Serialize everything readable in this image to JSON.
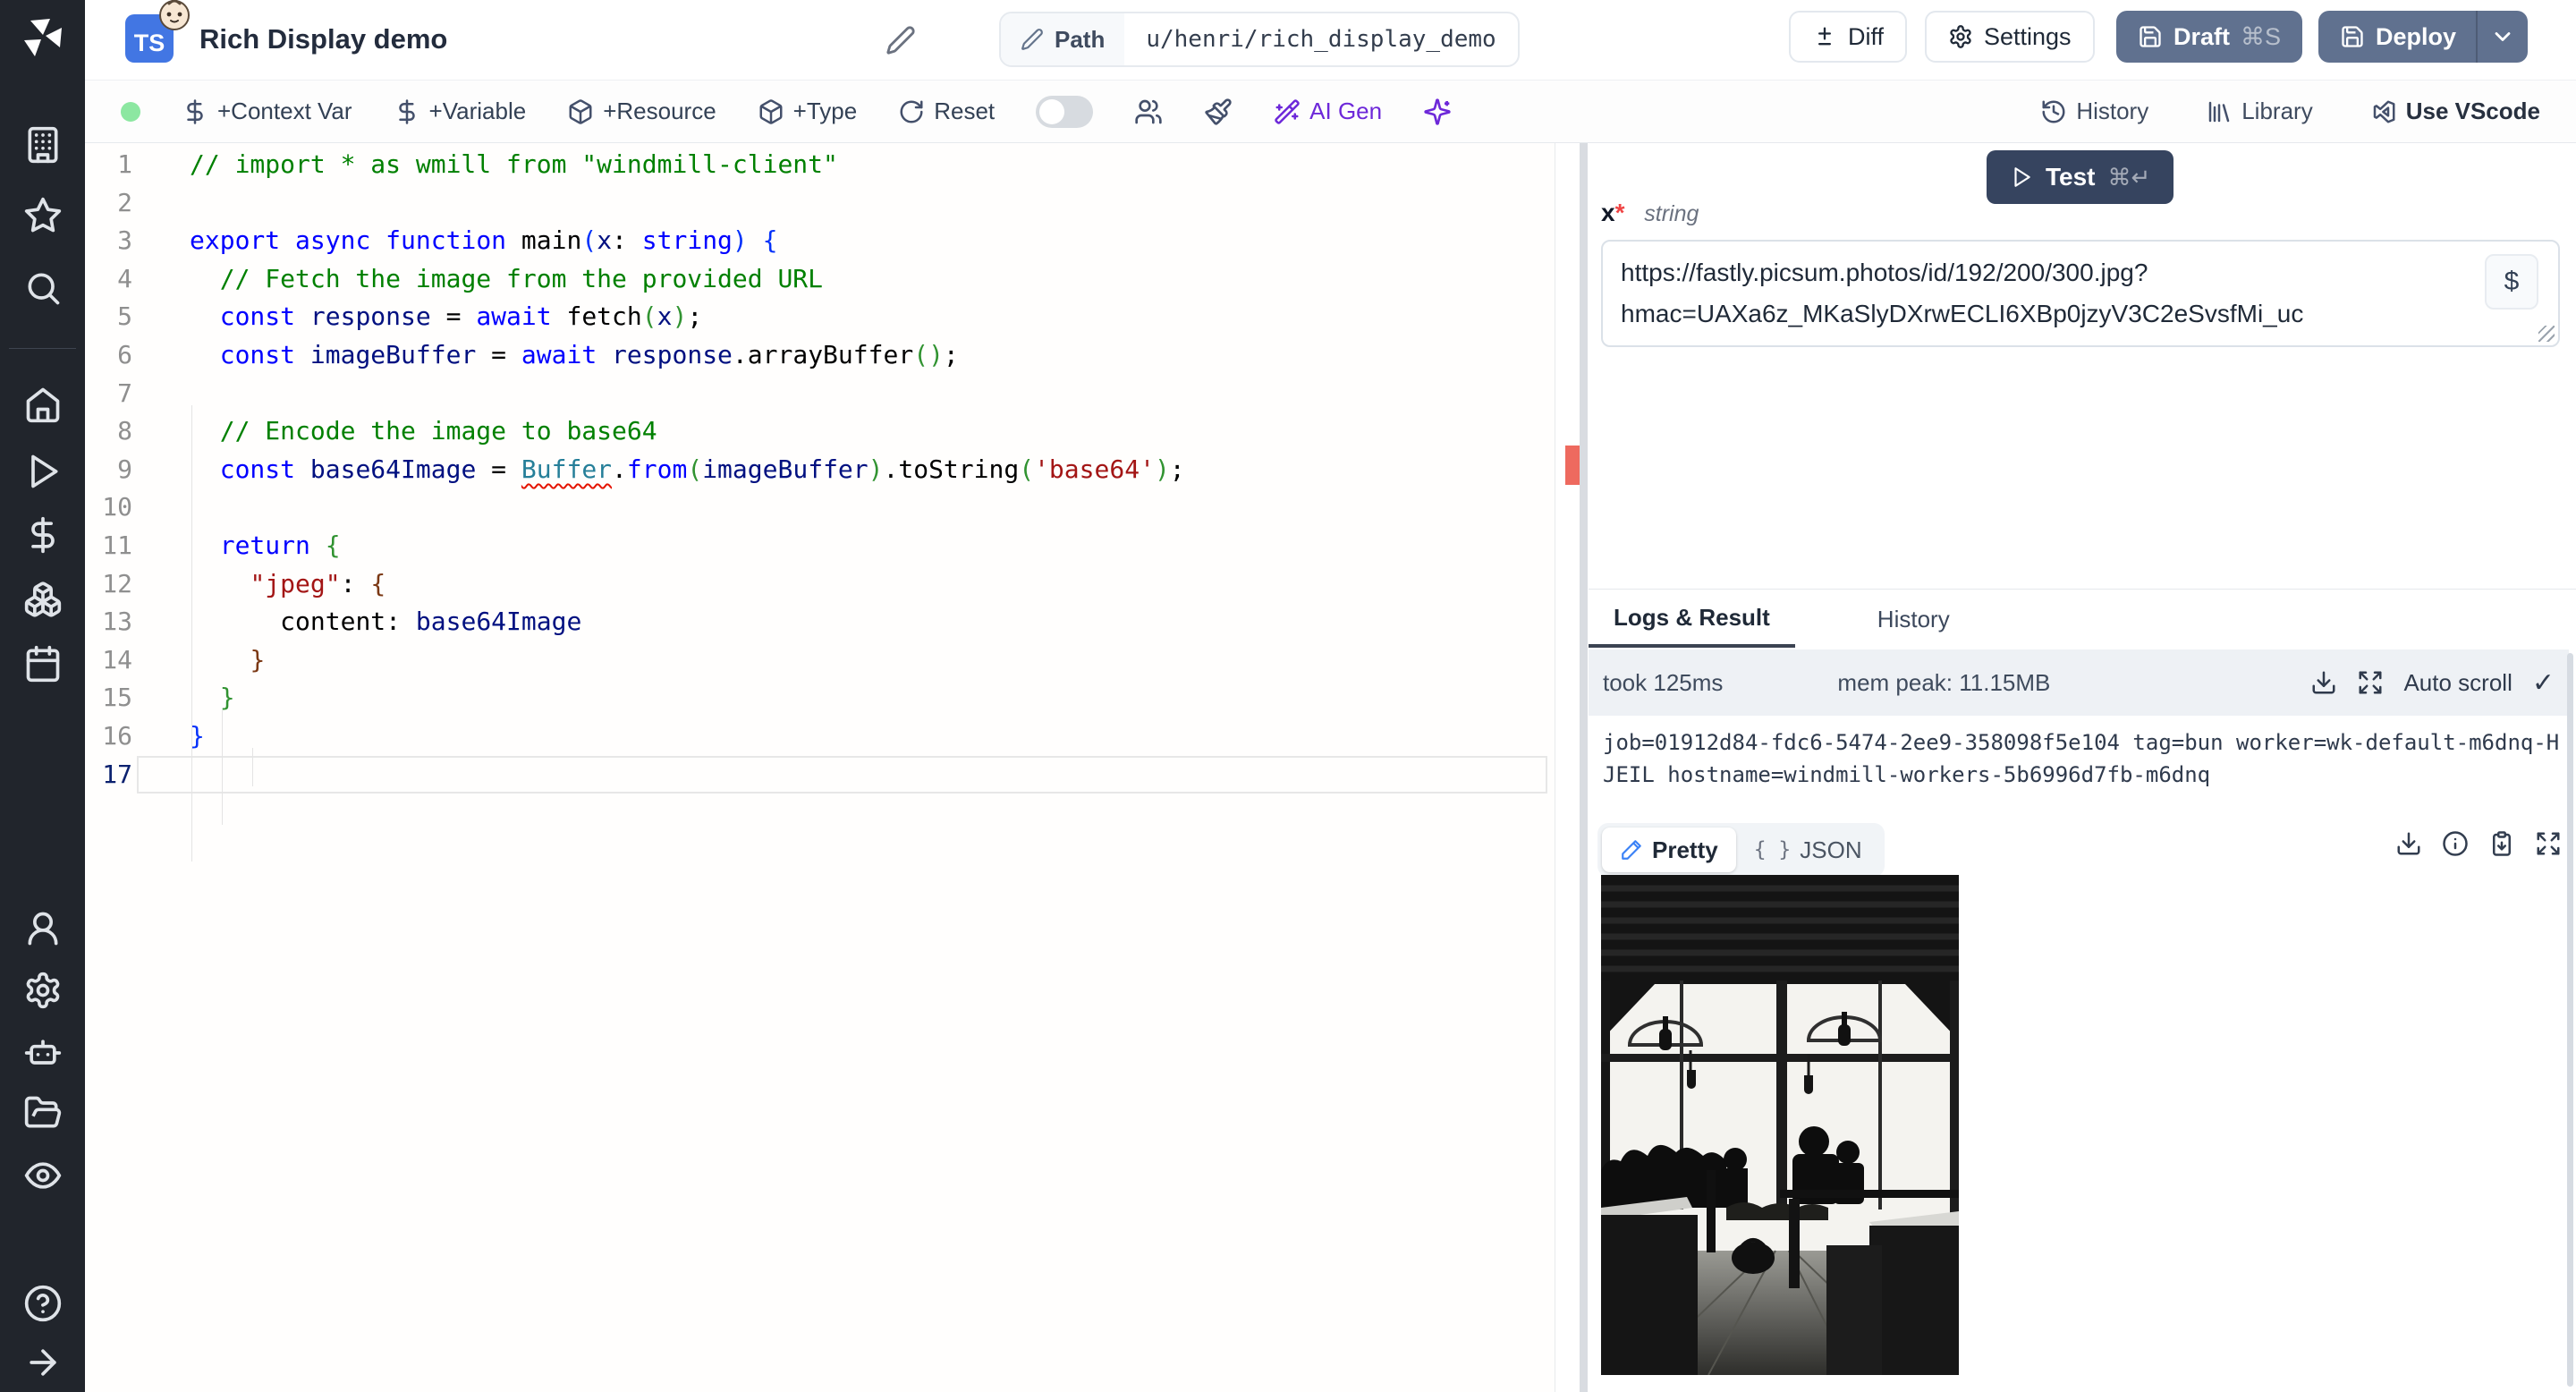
{
  "sidebar": {
    "icons": [
      "building",
      "star",
      "search",
      "home",
      "play",
      "dollar",
      "boxes",
      "calendar",
      "user",
      "settings",
      "bot",
      "folder-open",
      "eye",
      "help",
      "arrow-right"
    ]
  },
  "header": {
    "badge": "TS",
    "title": "Rich Display demo",
    "path_label": "Path",
    "path_value": "u/henri/rich_display_demo",
    "diff": "Diff",
    "settings": "Settings",
    "draft": "Draft",
    "draft_shortcut": "⌘S",
    "deploy": "Deploy"
  },
  "toolbar": {
    "context_var": "+Context Var",
    "variable": "+Variable",
    "resource": "+Resource",
    "type": "+Type",
    "reset": "Reset",
    "ai_gen": "AI Gen",
    "history": "History",
    "library": "Library",
    "use_vscode": "Use VScode"
  },
  "editor": {
    "lines": [
      {
        "n": "1",
        "tokens": [
          [
            "// import * as wmill from \"windmill-client\"",
            "cm"
          ]
        ]
      },
      {
        "n": "2",
        "tokens": []
      },
      {
        "n": "3",
        "tokens": [
          [
            "export",
            "kw"
          ],
          [
            " ",
            "df"
          ],
          [
            "async",
            "kw"
          ],
          [
            " ",
            "df"
          ],
          [
            "function",
            "kw"
          ],
          [
            " ",
            "df"
          ],
          [
            "main",
            "df"
          ],
          [
            "(",
            "b1"
          ],
          [
            "x",
            "vr"
          ],
          [
            ": ",
            "df"
          ],
          [
            "string",
            "kw"
          ],
          [
            ")",
            "b1"
          ],
          [
            " ",
            "df"
          ],
          [
            "{",
            "b1"
          ]
        ]
      },
      {
        "n": "4",
        "tokens": [
          [
            "  ",
            "df"
          ],
          [
            "// Fetch the image from the provided URL",
            "cm"
          ]
        ]
      },
      {
        "n": "5",
        "tokens": [
          [
            "  ",
            "df"
          ],
          [
            "const",
            "kw"
          ],
          [
            " ",
            "df"
          ],
          [
            "response",
            "vr"
          ],
          [
            " = ",
            "df"
          ],
          [
            "await",
            "kw"
          ],
          [
            " ",
            "df"
          ],
          [
            "fetch",
            "df"
          ],
          [
            "(",
            "b2"
          ],
          [
            "x",
            "vr"
          ],
          [
            ")",
            "b2"
          ],
          [
            ";",
            "df"
          ]
        ]
      },
      {
        "n": "6",
        "tokens": [
          [
            "  ",
            "df"
          ],
          [
            "const",
            "kw"
          ],
          [
            " ",
            "df"
          ],
          [
            "imageBuffer",
            "vr"
          ],
          [
            " = ",
            "df"
          ],
          [
            "await",
            "kw"
          ],
          [
            " ",
            "df"
          ],
          [
            "response",
            "vr"
          ],
          [
            ".",
            "df"
          ],
          [
            "arrayBuffer",
            "df"
          ],
          [
            "(",
            "b2"
          ],
          [
            ")",
            "b2"
          ],
          [
            ";",
            "df"
          ]
        ]
      },
      {
        "n": "7",
        "tokens": []
      },
      {
        "n": "8",
        "tokens": [
          [
            "  ",
            "df"
          ],
          [
            "// Encode the image to base64",
            "cm"
          ]
        ]
      },
      {
        "n": "9",
        "tokens": [
          [
            "  ",
            "df"
          ],
          [
            "const",
            "kw"
          ],
          [
            " ",
            "df"
          ],
          [
            "base64Image",
            "vr"
          ],
          [
            " = ",
            "df"
          ],
          [
            "Buffer",
            "er"
          ],
          [
            ".",
            "df"
          ],
          [
            "from",
            "kw"
          ],
          [
            "(",
            "b2"
          ],
          [
            "imageBuffer",
            "vr"
          ],
          [
            ")",
            "b2"
          ],
          [
            ".",
            "df"
          ],
          [
            "toString",
            "df"
          ],
          [
            "(",
            "b2"
          ],
          [
            "'base64'",
            "st"
          ],
          [
            ")",
            "b2"
          ],
          [
            ";",
            "df"
          ]
        ]
      },
      {
        "n": "10",
        "tokens": []
      },
      {
        "n": "11",
        "tokens": [
          [
            "  ",
            "df"
          ],
          [
            "return",
            "kw"
          ],
          [
            " ",
            "df"
          ],
          [
            "{",
            "b2"
          ]
        ]
      },
      {
        "n": "12",
        "tokens": [
          [
            "    ",
            "df"
          ],
          [
            "\"jpeg\"",
            "st"
          ],
          [
            ": ",
            "df"
          ],
          [
            "{",
            "b3"
          ]
        ]
      },
      {
        "n": "13",
        "tokens": [
          [
            "      ",
            "df"
          ],
          [
            "content",
            "df"
          ],
          [
            ": ",
            "df"
          ],
          [
            "base64Image",
            "vr"
          ]
        ]
      },
      {
        "n": "14",
        "tokens": [
          [
            "    ",
            "df"
          ],
          [
            "}",
            "b3"
          ]
        ]
      },
      {
        "n": "15",
        "tokens": [
          [
            "  ",
            "df"
          ],
          [
            "}",
            "b2"
          ]
        ]
      },
      {
        "n": "16",
        "tokens": [
          [
            "}",
            "b1"
          ]
        ]
      },
      {
        "n": "17",
        "tokens": [],
        "current": true
      }
    ]
  },
  "runner": {
    "test": "Test",
    "test_shortcut": "⌘↵",
    "arg_name": "x",
    "arg_required": "*",
    "arg_type": "string",
    "arg_value": "https://fastly.picsum.photos/id/192/200/300.jpg?hmac=UAXa6z_MKaSlyDXrwECLI6XBp0jzyV3C2eSvsfMi_uc",
    "var_picker": "$"
  },
  "results": {
    "tab_logs": "Logs & Result",
    "tab_history": "History",
    "took": "took 125ms",
    "mem": "mem peak: 11.15MB",
    "autoscroll": "Auto scroll",
    "check": "✓",
    "log": "job=01912d84-fdc6-5474-2ee9-358098f5e104 tag=bun worker=wk-default-m6dnq-HJEIL hostname=windmill-workers-5b6996d7fb-m6dnq",
    "pretty": "Pretty",
    "json_glyph": "{ }",
    "json": "JSON",
    "image_description": "black and white photo of a cafe interior: silhouettes of people seated at tables in front of a large gridded window with pendant lamps and a wooden floor"
  },
  "colors": {
    "accent_blue": "#4276e3",
    "deploy_button": "#60718f",
    "test_button": "#36445f",
    "ai_purple": "#6d28d9",
    "status_green": "#8ce7a1",
    "error_red": "#e51400"
  }
}
